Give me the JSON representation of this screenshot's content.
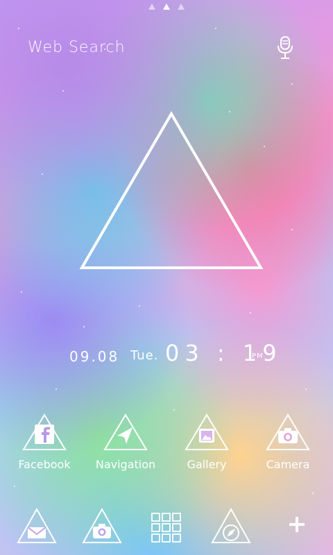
{
  "search": {
    "label": "Web Search"
  },
  "clock": {
    "date": "09.08",
    "day": "Tue.",
    "time": "03 : 19",
    "ampm": "PM"
  },
  "apps": [
    {
      "label": "Facebook",
      "icon": "facebook-icon"
    },
    {
      "label": "Navigation",
      "icon": "navigation-arrow-icon"
    },
    {
      "label": "Gallery",
      "icon": "gallery-icon"
    },
    {
      "label": "Camera",
      "icon": "camera-icon"
    }
  ],
  "dock": [
    {
      "icon": "mail-icon"
    },
    {
      "icon": "camera-icon"
    },
    {
      "icon": "app-drawer-grid-icon"
    },
    {
      "icon": "compass-icon"
    },
    {
      "icon": "plus-icon"
    }
  ],
  "colors": {
    "accent": "#ffffff"
  }
}
